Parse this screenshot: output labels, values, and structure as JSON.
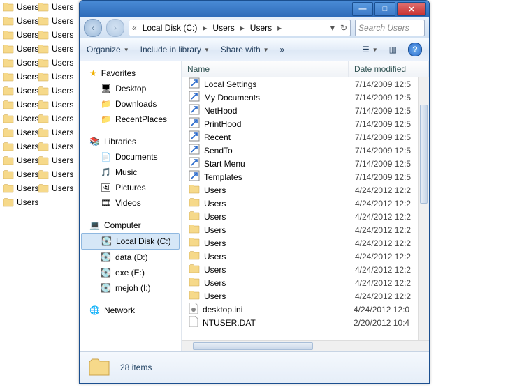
{
  "desktop_icons": {
    "label": "Users",
    "count_col1": 15,
    "count_col2": 14
  },
  "titlebar": {
    "min": "—",
    "max": "□",
    "close": "✕"
  },
  "address": {
    "back": "‹",
    "forward": "›",
    "pre": "«",
    "segs": [
      "Local Disk (C:)",
      "Users",
      "Users"
    ],
    "sep": "▸",
    "refresh": "↻"
  },
  "search": {
    "placeholder": "Search Users"
  },
  "toolbar": {
    "organize": "Organize",
    "include": "Include in library",
    "share": "Share with",
    "burn": "»"
  },
  "nav": {
    "favorites": {
      "label": "Favorites",
      "items": [
        "Desktop",
        "Downloads",
        "RecentPlaces"
      ]
    },
    "libraries": {
      "label": "Libraries",
      "items": [
        "Documents",
        "Music",
        "Pictures",
        "Videos"
      ]
    },
    "computer": {
      "label": "Computer",
      "items": [
        "Local Disk (C:)",
        "data (D:)",
        "exe (E:)",
        "mejoh (I:)"
      ],
      "selected": 0
    },
    "network": {
      "label": "Network"
    }
  },
  "columns": {
    "name": "Name",
    "date": "Date modified"
  },
  "files": [
    {
      "icon": "shortcut",
      "name": "Local Settings",
      "date": "7/14/2009 12:5"
    },
    {
      "icon": "shortcut",
      "name": "My Documents",
      "date": "7/14/2009 12:5"
    },
    {
      "icon": "shortcut",
      "name": "NetHood",
      "date": "7/14/2009 12:5"
    },
    {
      "icon": "shortcut",
      "name": "PrintHood",
      "date": "7/14/2009 12:5"
    },
    {
      "icon": "shortcut",
      "name": "Recent",
      "date": "7/14/2009 12:5"
    },
    {
      "icon": "shortcut",
      "name": "SendTo",
      "date": "7/14/2009 12:5"
    },
    {
      "icon": "shortcut",
      "name": "Start Menu",
      "date": "7/14/2009 12:5"
    },
    {
      "icon": "shortcut",
      "name": "Templates",
      "date": "7/14/2009 12:5"
    },
    {
      "icon": "folder",
      "name": "Users",
      "date": "4/24/2012 12:2"
    },
    {
      "icon": "folder",
      "name": "Users",
      "date": "4/24/2012 12:2"
    },
    {
      "icon": "folder",
      "name": "Users",
      "date": "4/24/2012 12:2"
    },
    {
      "icon": "folder",
      "name": "Users",
      "date": "4/24/2012 12:2"
    },
    {
      "icon": "folder",
      "name": "Users",
      "date": "4/24/2012 12:2"
    },
    {
      "icon": "folder",
      "name": "Users",
      "date": "4/24/2012 12:2"
    },
    {
      "icon": "folder",
      "name": "Users",
      "date": "4/24/2012 12:2"
    },
    {
      "icon": "folder",
      "name": "Users",
      "date": "4/24/2012 12:2"
    },
    {
      "icon": "folder",
      "name": "Users",
      "date": "4/24/2012 12:2"
    },
    {
      "icon": "ini",
      "name": "desktop.ini",
      "date": "4/24/2012 12:0"
    },
    {
      "icon": "file",
      "name": "NTUSER.DAT",
      "date": "2/20/2012 10:4"
    }
  ],
  "status": {
    "count": "28 items"
  }
}
